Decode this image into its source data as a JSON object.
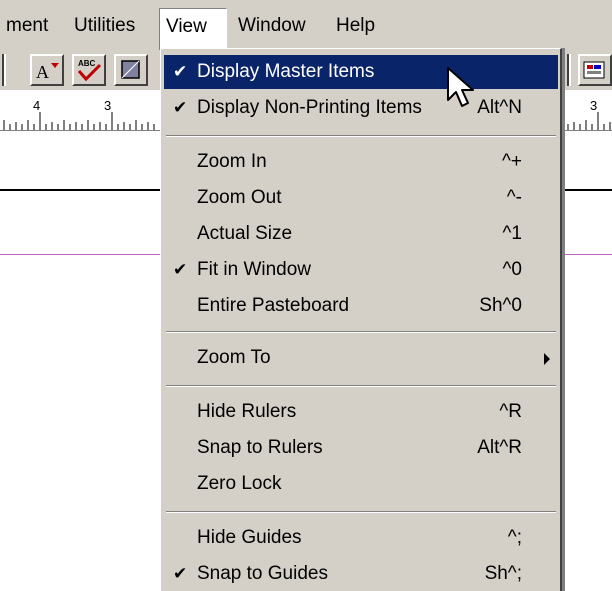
{
  "menubar": {
    "items": [
      {
        "label": "ment"
      },
      {
        "label": "Utilities"
      },
      {
        "label": "View"
      },
      {
        "label": "Window"
      },
      {
        "label": "Help"
      }
    ]
  },
  "ruler": {
    "left_numbers": [
      "4",
      "3"
    ],
    "right_numbers": [
      "3"
    ]
  },
  "view_menu": {
    "items": [
      {
        "label": "Display Master Items",
        "shortcut": "",
        "checked": "✔",
        "highlighted": true
      },
      {
        "label": "Display Non-Printing Items",
        "shortcut": "Alt^N",
        "checked": "✔"
      },
      {
        "label": "Zoom In",
        "shortcut": "^+",
        "checked": ""
      },
      {
        "label": "Zoom Out",
        "shortcut": "^-",
        "checked": ""
      },
      {
        "label": "Actual Size",
        "shortcut": "^1",
        "checked": ""
      },
      {
        "label": "Fit in Window",
        "shortcut": "^0",
        "checked": "✔"
      },
      {
        "label": "Entire Pasteboard",
        "shortcut": "Sh^0",
        "checked": ""
      },
      {
        "label": "Zoom To",
        "shortcut": "",
        "checked": "",
        "submenu": true
      },
      {
        "label": "Hide Rulers",
        "shortcut": "^R",
        "checked": ""
      },
      {
        "label": "Snap to Rulers",
        "shortcut": "Alt^R",
        "checked": ""
      },
      {
        "label": "Zero Lock",
        "shortcut": "",
        "checked": ""
      },
      {
        "label": "Hide Guides",
        "shortcut": "^;",
        "checked": ""
      },
      {
        "label": "Snap to Guides",
        "shortcut": "Sh^;",
        "checked": "✔"
      }
    ]
  },
  "colors": {
    "menu_bg": "#d4d0c8",
    "highlight": "#0a246a",
    "guide": "#c060c0"
  }
}
